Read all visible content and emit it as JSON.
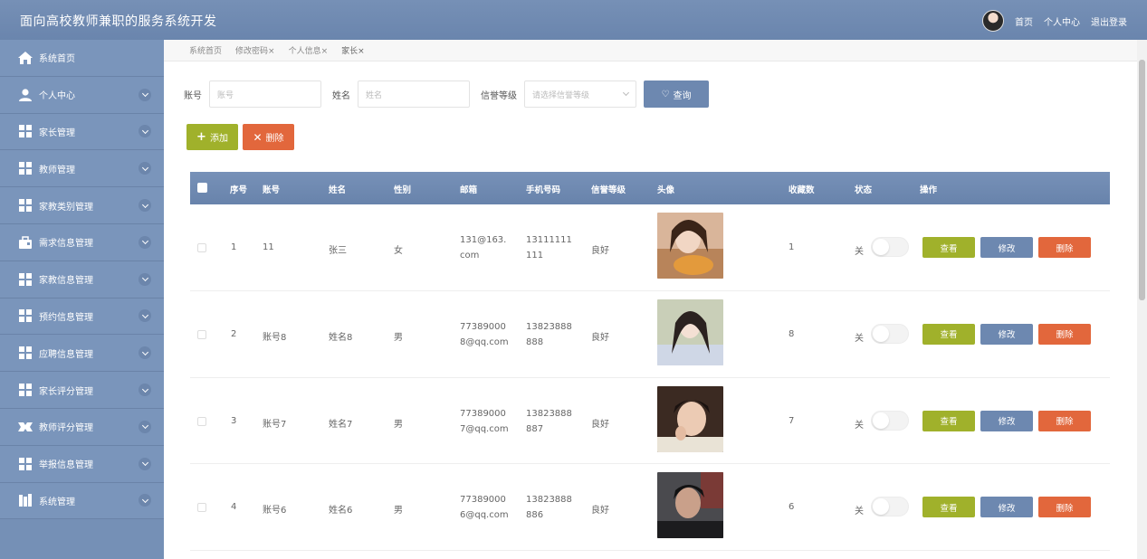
{
  "header": {
    "title": "面向高校教师兼职的服务系统开发",
    "links": [
      "首页",
      "个人中心",
      "退出登录"
    ]
  },
  "sidebar": {
    "items": [
      {
        "label": "系统首页",
        "icon": "home-icon",
        "expandable": false
      },
      {
        "label": "个人中心",
        "icon": "user-icon",
        "expandable": true
      },
      {
        "label": "家长管理",
        "icon": "grid-icon",
        "expandable": true
      },
      {
        "label": "教师管理",
        "icon": "grid-icon",
        "expandable": true
      },
      {
        "label": "家教类别管理",
        "icon": "grid-icon",
        "expandable": true
      },
      {
        "label": "需求信息管理",
        "icon": "briefcase-icon",
        "expandable": true
      },
      {
        "label": "家教信息管理",
        "icon": "grid-icon",
        "expandable": true
      },
      {
        "label": "预约信息管理",
        "icon": "grid-icon",
        "expandable": true
      },
      {
        "label": "应聘信息管理",
        "icon": "grid-icon",
        "expandable": true
      },
      {
        "label": "家长评分管理",
        "icon": "grid-icon",
        "expandable": true
      },
      {
        "label": "教师评分管理",
        "icon": "puzzle-icon",
        "expandable": true
      },
      {
        "label": "举报信息管理",
        "icon": "grid-icon",
        "expandable": true
      },
      {
        "label": "系统管理",
        "icon": "book-icon",
        "expandable": true
      }
    ]
  },
  "tabs": [
    "系统首页",
    "修改密码",
    "个人信息",
    "家长"
  ],
  "search": {
    "account_label": "账号",
    "account_placeholder": "账号",
    "name_label": "姓名",
    "name_placeholder": "姓名",
    "credit_label": "信誉等级",
    "credit_placeholder": "请选择信誉等级",
    "query_label": "查询"
  },
  "toolbar": {
    "add_label": "添加",
    "delete_label": "删除"
  },
  "table": {
    "columns": [
      "序号",
      "账号",
      "姓名",
      "性别",
      "邮箱",
      "手机号码",
      "信誉等级",
      "头像",
      "收藏数",
      "状态",
      "操作"
    ],
    "rows": [
      {
        "index": "1",
        "account": "11",
        "name": "张三",
        "gender": "女",
        "email": "131@163.com",
        "phone": "13111111111",
        "credit": "良好",
        "favorites": "1",
        "status": "关"
      },
      {
        "index": "2",
        "account": "账号8",
        "name": "姓名8",
        "gender": "男",
        "email": "773890008@qq.com",
        "phone": "13823888888",
        "credit": "良好",
        "favorites": "8",
        "status": "关"
      },
      {
        "index": "3",
        "account": "账号7",
        "name": "姓名7",
        "gender": "男",
        "email": "773890007@qq.com",
        "phone": "13823888887",
        "credit": "良好",
        "favorites": "7",
        "status": "关"
      },
      {
        "index": "4",
        "account": "账号6",
        "name": "姓名6",
        "gender": "男",
        "email": "773890006@qq.com",
        "phone": "13823888886",
        "credit": "良好",
        "favorites": "6",
        "status": "关"
      }
    ],
    "actions": {
      "view": "查看",
      "edit": "修改",
      "delete": "删除"
    }
  }
}
